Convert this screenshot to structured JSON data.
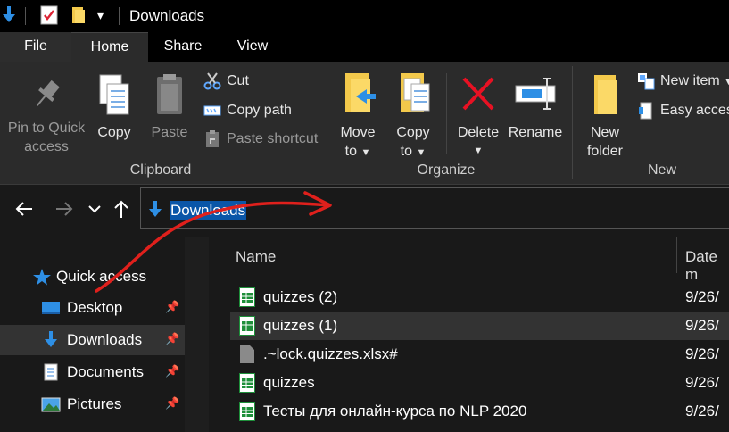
{
  "window": {
    "title": "Downloads"
  },
  "ribbon_tabs": [
    {
      "label": "File"
    },
    {
      "label": "Home"
    },
    {
      "label": "Share"
    },
    {
      "label": "View"
    }
  ],
  "clipboard": {
    "pin_line1": "Pin to Quick",
    "pin_line2": "access",
    "copy": "Copy",
    "paste": "Paste",
    "cut": "Cut",
    "copy_path": "Copy path",
    "paste_shortcut": "Paste shortcut",
    "group": "Clipboard"
  },
  "organize": {
    "move_line1": "Move",
    "move_line2": "to",
    "copy_line1": "Copy",
    "copy_line2": "to",
    "delete": "Delete",
    "rename": "Rename",
    "group": "Organize"
  },
  "new_group": {
    "new_folder_line1": "New",
    "new_folder_line2": "folder",
    "new_item": "New item",
    "easy_access": "Easy access",
    "group": "New"
  },
  "address": {
    "path": "Downloads"
  },
  "sidebar": {
    "items": [
      {
        "label": "Quick access",
        "icon": "star-icon"
      },
      {
        "label": "Desktop",
        "icon": "desktop-icon"
      },
      {
        "label": "Downloads",
        "icon": "download-arrow-icon"
      },
      {
        "label": "Documents",
        "icon": "documents-icon"
      },
      {
        "label": "Pictures",
        "icon": "pictures-icon"
      }
    ]
  },
  "columns": {
    "name": "Name",
    "date": "Date m"
  },
  "files": [
    {
      "name": "quizzes (2)",
      "date": "9/26/",
      "type": "sheet"
    },
    {
      "name": "quizzes (1)",
      "date": "9/26/",
      "type": "sheet"
    },
    {
      "name": ".~lock.quizzes.xlsx#",
      "date": "9/26/",
      "type": "file"
    },
    {
      "name": "quizzes",
      "date": "9/26/",
      "type": "sheet"
    },
    {
      "name": "Тесты для онлайн-курса по NLP 2020",
      "date": "9/26/",
      "type": "sheet"
    }
  ],
  "colors": {
    "accent_blue": "#2e8fe5",
    "selection": "#0a56a8",
    "annotation_red": "#e0201c",
    "sheet_green": "#1e8f3a"
  }
}
